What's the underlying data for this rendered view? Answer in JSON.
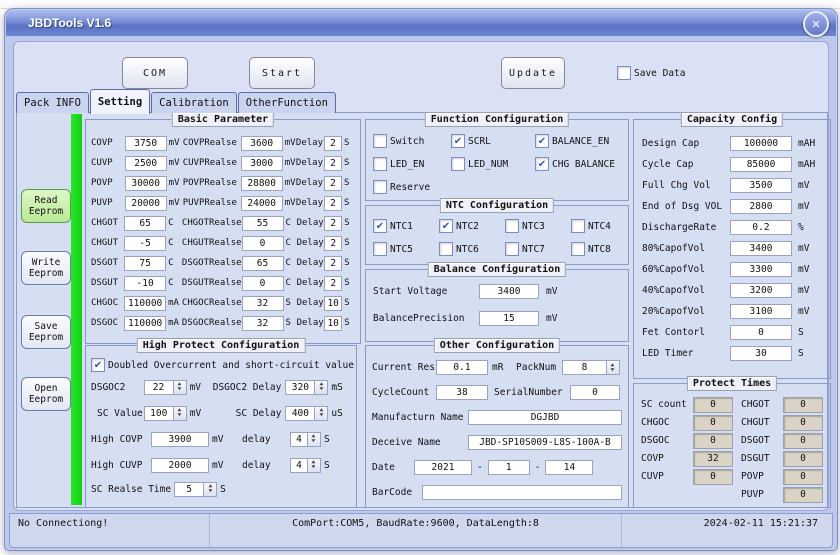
{
  "window": {
    "title": "JBDTools V1.6",
    "close_glyph": "✕"
  },
  "colors": {
    "titlebar_blue": "#6b82ca",
    "frame_blue": "#bcc8ec",
    "panel_lavender": "#d6def2",
    "progress_green": "#1edc1e",
    "active_button_green": "#c9efad",
    "protect_value_bg": "#d9d4c5"
  },
  "toolbar": {
    "com": "COM",
    "start": "Start",
    "update": "Update",
    "save_data": {
      "label": "Save Data",
      "checked": false
    }
  },
  "tabs": [
    {
      "label": "Pack INFO"
    },
    {
      "label": "Setting"
    },
    {
      "label": "Calibration"
    },
    {
      "label": "OtherFunction"
    }
  ],
  "side_buttons": [
    {
      "line1": "Read",
      "line2": "Eeprom"
    },
    {
      "line1": "Write",
      "line2": "Eeprom"
    },
    {
      "line1": "Save",
      "line2": "Eeprom"
    },
    {
      "line1": "Open",
      "line2": "Eeprom"
    }
  ],
  "basic": {
    "title": "Basic Parameter",
    "delay_label": "Delay",
    "s_label": "S",
    "rows": [
      {
        "l": "COVP",
        "v": "3750",
        "u": "mV",
        "rl": "COVPRealse",
        "rv": "3600",
        "ru": "mV",
        "d": "2"
      },
      {
        "l": "CUVP",
        "v": "2500",
        "u": "mV",
        "rl": "CUVPRealse",
        "rv": "3000",
        "ru": "mV",
        "d": "2"
      },
      {
        "l": "POVP",
        "v": "30000",
        "u": "mV",
        "rl": "POVPRealse",
        "rv": "28800",
        "ru": "mV",
        "d": "2"
      },
      {
        "l": "PUVP",
        "v": "20000",
        "u": "mV",
        "rl": "PUVPRealse",
        "rv": "24000",
        "ru": "mV",
        "d": "2"
      },
      {
        "l": "CHGOT",
        "v": "65",
        "u": "C",
        "rl": "CHGOTRealse",
        "rv": "55",
        "ru": "C",
        "d": "2"
      },
      {
        "l": "CHGUT",
        "v": "-5",
        "u": "C",
        "rl": "CHGUTRealse",
        "rv": "0",
        "ru": "C",
        "d": "2"
      },
      {
        "l": "DSGOT",
        "v": "75",
        "u": "C",
        "rl": "DSGOTRealse",
        "rv": "65",
        "ru": "C",
        "d": "2"
      },
      {
        "l": "DSGUT",
        "v": "-10",
        "u": "C",
        "rl": "DSGUTRealse",
        "rv": "0",
        "ru": "C",
        "d": "2"
      },
      {
        "l": "CHGOC",
        "v": "110000",
        "u": "mA",
        "rl": "CHGOCRealse",
        "rv": "32",
        "ru": "S",
        "d": "10"
      },
      {
        "l": "DSGOC",
        "v": "110000",
        "u": "mA",
        "rl": "DSGOCRealse",
        "rv": "32",
        "ru": "S",
        "d": "10"
      }
    ]
  },
  "high_protect": {
    "title": "High Protect Configuration",
    "doubled": {
      "label": "Doubled Overcurrent and short-circuit value",
      "checked": true
    },
    "dsgoc2": {
      "label": "DSGOC2",
      "value": "22",
      "unit": "mV"
    },
    "dsgoc2_delay": {
      "label": "DSGOC2 Delay",
      "value": "320",
      "unit": "mS"
    },
    "sc_value": {
      "label": "SC Value",
      "value": "100",
      "unit": "mV"
    },
    "sc_delay": {
      "label": "SC Delay",
      "value": "400",
      "unit": "uS"
    },
    "high_covp": {
      "label": "High COVP",
      "value": "3900",
      "unit": "mV",
      "delay_label": "delay",
      "delay": "4",
      "delay_unit": "S"
    },
    "high_cuvp": {
      "label": "High CUVP",
      "value": "2000",
      "unit": "mV",
      "delay_label": "delay",
      "delay": "4",
      "delay_unit": "S"
    },
    "sc_realse": {
      "label": "SC Realse Time",
      "value": "5",
      "unit": "S"
    }
  },
  "function_config": {
    "title": "Function Configuration",
    "items": [
      {
        "label": "Switch",
        "checked": false
      },
      {
        "label": "SCRL",
        "checked": true
      },
      {
        "label": "BALANCE_EN",
        "checked": true
      },
      {
        "label": "LED_EN",
        "checked": false
      },
      {
        "label": "LED_NUM",
        "checked": false
      },
      {
        "label": "CHG BALANCE",
        "checked": true
      },
      {
        "label": "Reserve",
        "checked": false
      }
    ]
  },
  "ntc": {
    "title": "NTC Configuration",
    "items": [
      {
        "label": "NTC1",
        "checked": true
      },
      {
        "label": "NTC2",
        "checked": true
      },
      {
        "label": "NTC3",
        "checked": false
      },
      {
        "label": "NTC4",
        "checked": false
      },
      {
        "label": "NTC5",
        "checked": false
      },
      {
        "label": "NTC6",
        "checked": false
      },
      {
        "label": "NTC7",
        "checked": false
      },
      {
        "label": "NTC8",
        "checked": false
      }
    ]
  },
  "balance": {
    "title": "Balance Configuration",
    "start_voltage": {
      "label": "Start Voltage",
      "value": "3400",
      "unit": "mV"
    },
    "precision": {
      "label": "BalancePrecision",
      "value": "15",
      "unit": "mV"
    }
  },
  "other": {
    "title": "Other Configuration",
    "current_res": {
      "label": "Current Res",
      "value": "0.1",
      "unit": "mR"
    },
    "pack_num": {
      "label": "PackNum",
      "value": "8"
    },
    "cycle_count": {
      "label": "CycleCount",
      "value": "38"
    },
    "serial_number": {
      "label": "SerialNumber",
      "value": "0"
    },
    "manufacturer": {
      "label": "Manufacturn Name",
      "value": "DGJBD"
    },
    "device": {
      "label": "Deceive Name",
      "value": "JBD-SP10S009-L8S-100A-B"
    },
    "date": {
      "label": "Date",
      "year": "2021",
      "sep": "-",
      "month": "1",
      "day": "14"
    },
    "barcode": {
      "label": "BarCode",
      "value": ""
    }
  },
  "capacity": {
    "title": "Capacity Config",
    "rows": [
      {
        "l": "Design Cap",
        "v": "100000",
        "u": "mAH"
      },
      {
        "l": "Cycle Cap",
        "v": "85000",
        "u": "mAH"
      },
      {
        "l": "Full Chg Vol",
        "v": "3500",
        "u": "mV"
      },
      {
        "l": "End of Dsg VOL",
        "v": "2800",
        "u": "mV"
      },
      {
        "l": "DischargeRate",
        "v": "0.2",
        "u": "%"
      },
      {
        "l": "80%CapofVol",
        "v": "3400",
        "u": "mV"
      },
      {
        "l": "60%CapofVol",
        "v": "3300",
        "u": "mV"
      },
      {
        "l": "40%CapofVol",
        "v": "3200",
        "u": "mV"
      },
      {
        "l": "20%CapofVol",
        "v": "3100",
        "u": "mV"
      },
      {
        "l": "Fet Contorl",
        "v": "0",
        "u": "S"
      },
      {
        "l": "LED Timer",
        "v": "30",
        "u": "S"
      }
    ]
  },
  "protect_times": {
    "title": "Protect Times",
    "left": [
      {
        "l": "SC count",
        "v": "0"
      },
      {
        "l": "CHGOC",
        "v": "0"
      },
      {
        "l": "DSGOC",
        "v": "0"
      },
      {
        "l": "COVP",
        "v": "32"
      },
      {
        "l": "CUVP",
        "v": "0"
      }
    ],
    "right": [
      {
        "l": "CHGOT",
        "v": "0"
      },
      {
        "l": "CHGUT",
        "v": "0"
      },
      {
        "l": "DSGOT",
        "v": "0"
      },
      {
        "l": "DSGUT",
        "v": "0"
      },
      {
        "l": "POVP",
        "v": "0"
      },
      {
        "l": "PUVP",
        "v": "0"
      }
    ]
  },
  "status": {
    "left": "No Connectiong!",
    "center": "ComPort:COM5, BaudRate:9600, DataLength:8",
    "right": "2024-02-11 15:21:37"
  }
}
